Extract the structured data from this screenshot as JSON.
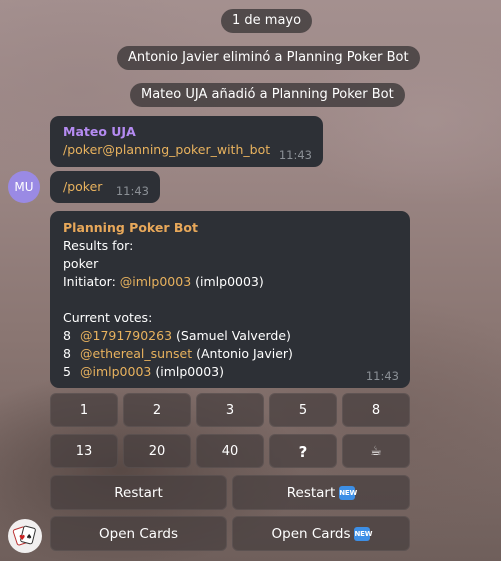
{
  "date_label": "1 de mayo",
  "service_messages": [
    "Antonio Javier eliminó a Planning Poker Bot",
    "Mateo UJA añadió a Planning Poker Bot"
  ],
  "messages": {
    "mateo_command": {
      "sender": "Mateo UJA",
      "text": "/poker@planning_poker_with_bot",
      "time": "11:43"
    },
    "mu_command": {
      "avatar_initials": "MU",
      "text": "/poker",
      "time": "11:43"
    },
    "bot_result": {
      "sender": "Planning Poker Bot",
      "line1": "Results for:",
      "line2": "poker",
      "initiator_label": "Initiator: ",
      "initiator_handle": "@imlp0003",
      "initiator_name": " (imlp0003)",
      "votes_header": "Current votes:",
      "votes": [
        {
          "value": "8",
          "handle": "@1791790263",
          "name": " (Samuel Valverde)"
        },
        {
          "value": "8",
          "handle": "@ethereal_sunset",
          "name": " (Antonio Javier)"
        },
        {
          "value": "5",
          "handle": "@imlp0003",
          "name": " (imlp0003)"
        }
      ],
      "time": "11:43"
    }
  },
  "keyboard": {
    "row1": [
      "1",
      "2",
      "3",
      "5",
      "8"
    ],
    "row2": [
      "13",
      "20",
      "40",
      "?",
      "☕"
    ],
    "restart": "Restart",
    "restart_new": "Restart",
    "open_cards": "Open Cards",
    "open_cards_new": "Open Cards",
    "new_badge": "NEW"
  },
  "colors": {
    "bubble_bg": "#2d3036",
    "sender_purple": "#b58bf2",
    "sender_orange": "#e8a85a",
    "link_gold": "#e8b25e",
    "avatar_purple": "#9a8ae4",
    "new_badge_blue": "#3d8fe6"
  },
  "icons": {
    "sticker": "playing-cards-sticker-icon",
    "coffee": "coffee-icon",
    "new": "new-badge-icon"
  }
}
